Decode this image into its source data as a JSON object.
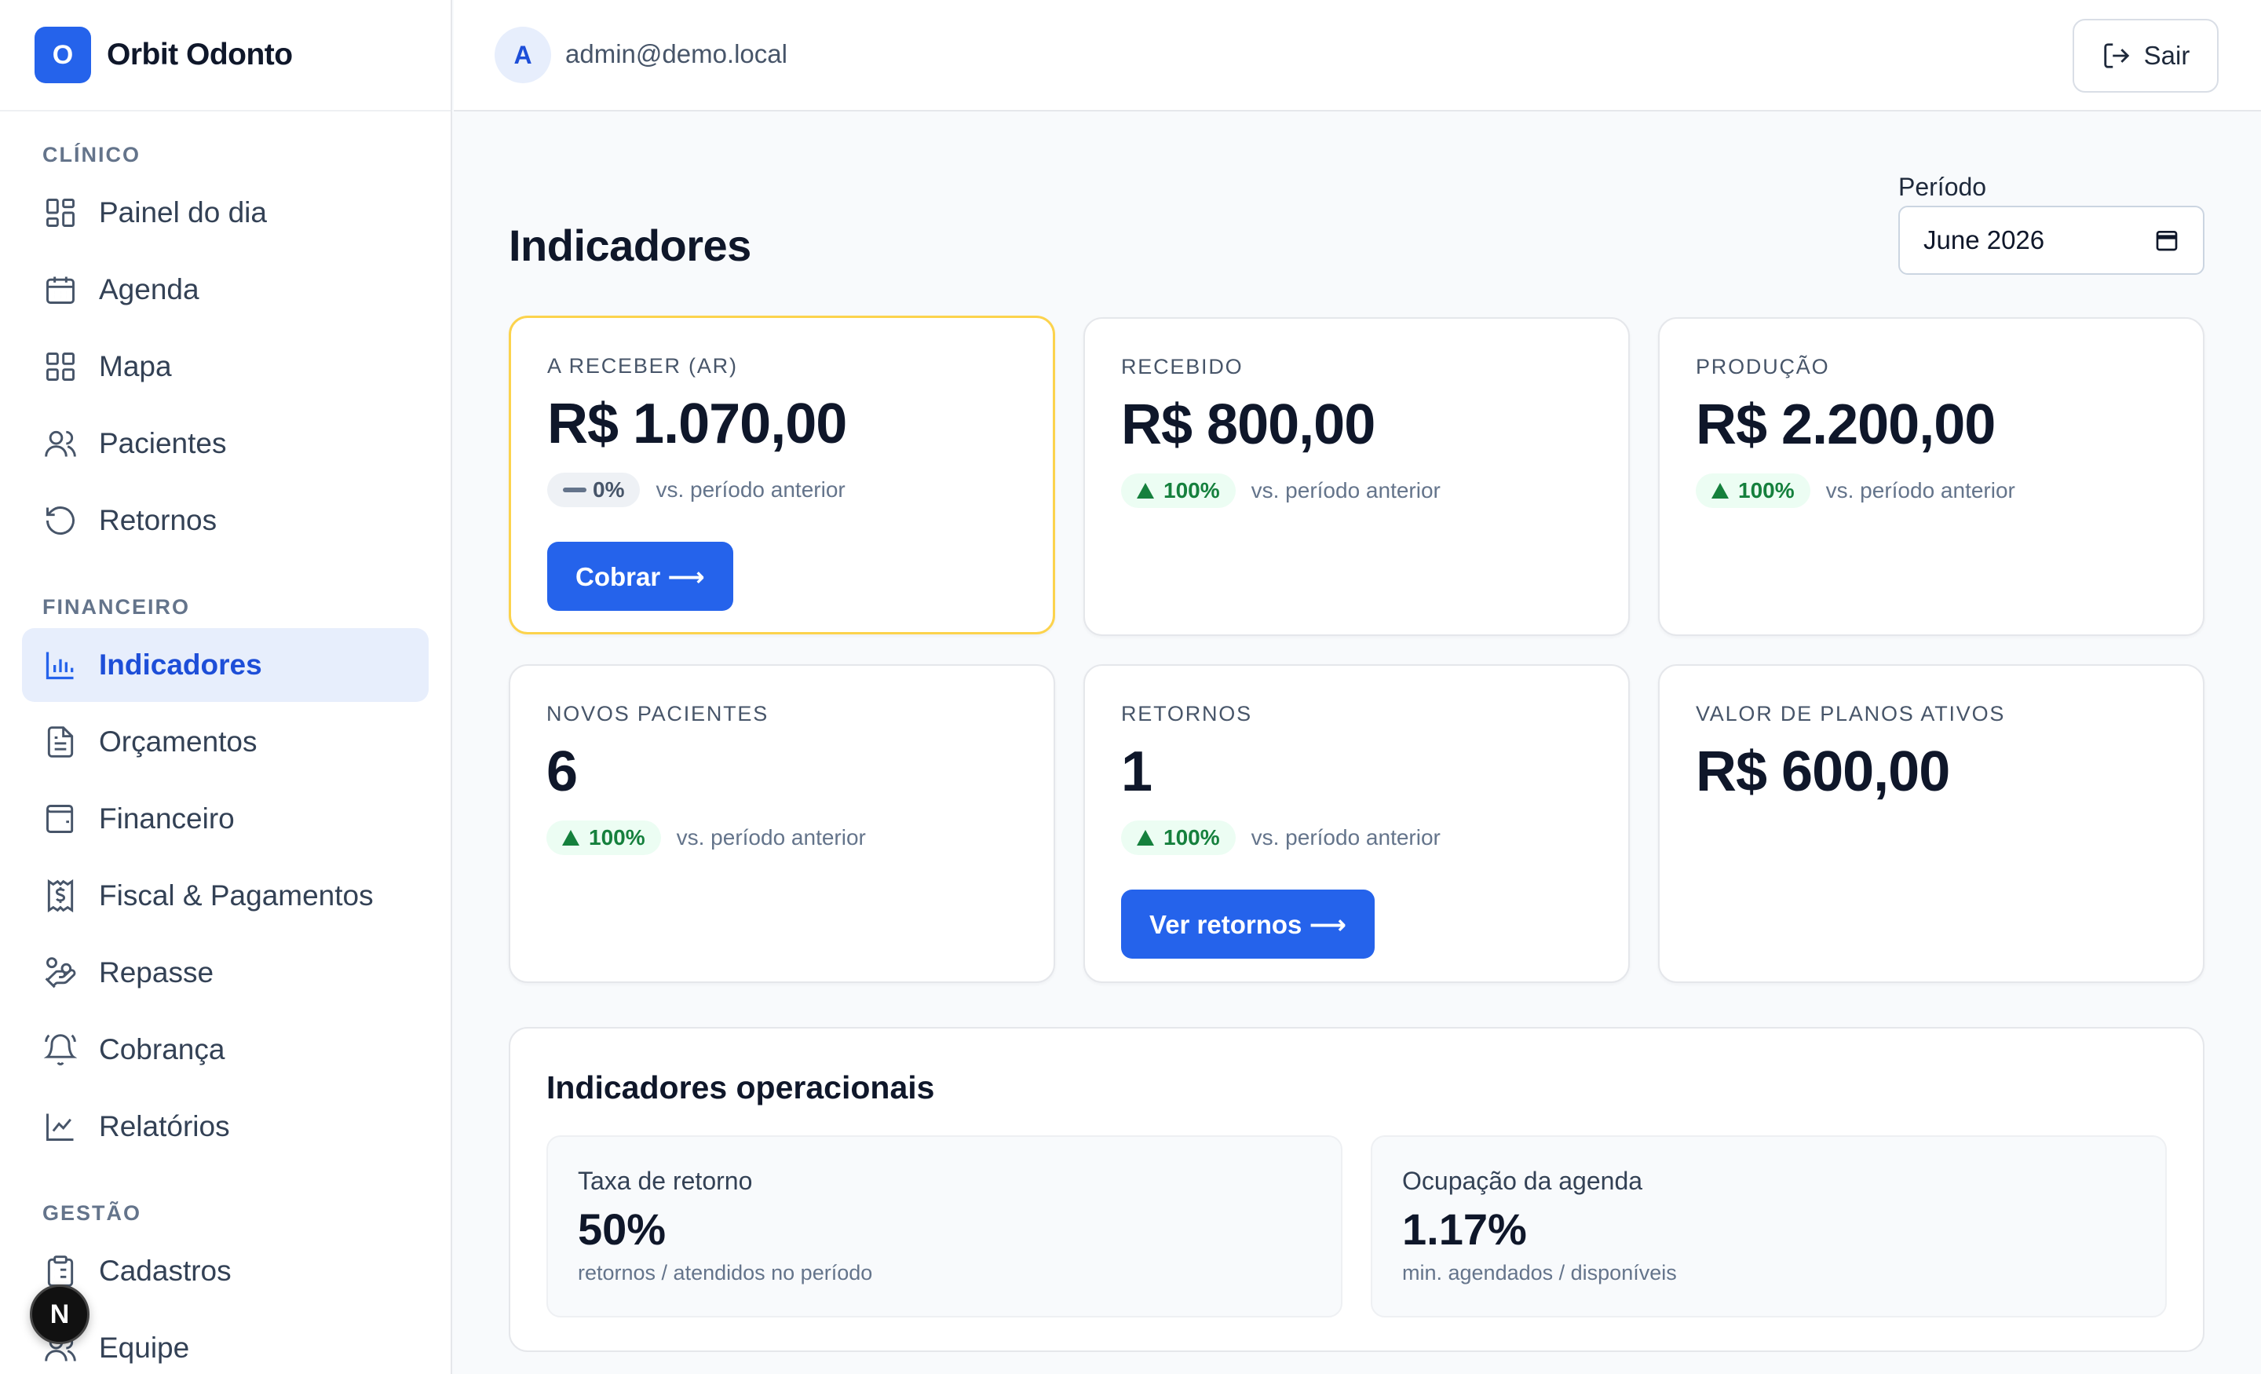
{
  "app": {
    "logo_letter": "O",
    "name": "Orbit Odonto"
  },
  "sidebar": {
    "sections": [
      {
        "label": "CLÍNICO"
      },
      {
        "label": "FINANCEIRO"
      },
      {
        "label": "GESTÃO"
      }
    ],
    "items": [
      {
        "label": "Painel do dia",
        "icon": "dashboard-icon"
      },
      {
        "label": "Agenda",
        "icon": "calendar-icon"
      },
      {
        "label": "Mapa",
        "icon": "grid-icon"
      },
      {
        "label": "Pacientes",
        "icon": "users-icon"
      },
      {
        "label": "Retornos",
        "icon": "rotate-icon"
      },
      {
        "label": "Indicadores",
        "icon": "bar-chart-icon",
        "active": true
      },
      {
        "label": "Orçamentos",
        "icon": "file-text-icon"
      },
      {
        "label": "Financeiro",
        "icon": "wallet-icon"
      },
      {
        "label": "Fiscal & Pagamentos",
        "icon": "receipt-icon"
      },
      {
        "label": "Repasse",
        "icon": "hand-coins-icon"
      },
      {
        "label": "Cobrança",
        "icon": "bell-ring-icon"
      },
      {
        "label": "Relatórios",
        "icon": "line-chart-icon"
      },
      {
        "label": "Cadastros",
        "icon": "clipboard-icon"
      },
      {
        "label": "Equipe",
        "icon": "users-icon"
      }
    ],
    "dev_badge": "N"
  },
  "header": {
    "avatar_letter": "A",
    "email": "admin@demo.local",
    "logout_label": "Sair"
  },
  "page": {
    "title": "Indicadores",
    "period_label": "Período",
    "period_value": "June 2026"
  },
  "cards": [
    {
      "label": "A RECEBER (AR)",
      "value": "R$ 1.070,00",
      "delta": "0%",
      "trend": "neutral",
      "note": "vs. período anterior",
      "button": "Cobrar ⟶"
    },
    {
      "label": "RECEBIDO",
      "value": "R$ 800,00",
      "delta": "100%",
      "trend": "up",
      "note": "vs. período anterior"
    },
    {
      "label": "PRODUÇÃO",
      "value": "R$ 2.200,00",
      "delta": "100%",
      "trend": "up",
      "note": "vs. período anterior"
    },
    {
      "label": "NOVOS PACIENTES",
      "value": "6",
      "delta": "100%",
      "trend": "up",
      "note": "vs. período anterior"
    },
    {
      "label": "RETORNOS",
      "value": "1",
      "delta": "100%",
      "trend": "up",
      "note": "vs. período anterior",
      "button": "Ver retornos ⟶"
    },
    {
      "label": "VALOR DE PLANOS ATIVOS",
      "value": "R$ 600,00"
    }
  ],
  "operational": {
    "title": "Indicadores operacionais",
    "metrics": [
      {
        "label": "Taxa de retorno",
        "value": "50%",
        "note": "retornos / atendidos no período"
      },
      {
        "label": "Ocupação da agenda",
        "value": "1.17%",
        "note": "min. agendados / disponíveis"
      }
    ]
  },
  "colors": {
    "accent": "#2563eb",
    "warning_border": "#fcd34d",
    "positive": "#15803d"
  }
}
